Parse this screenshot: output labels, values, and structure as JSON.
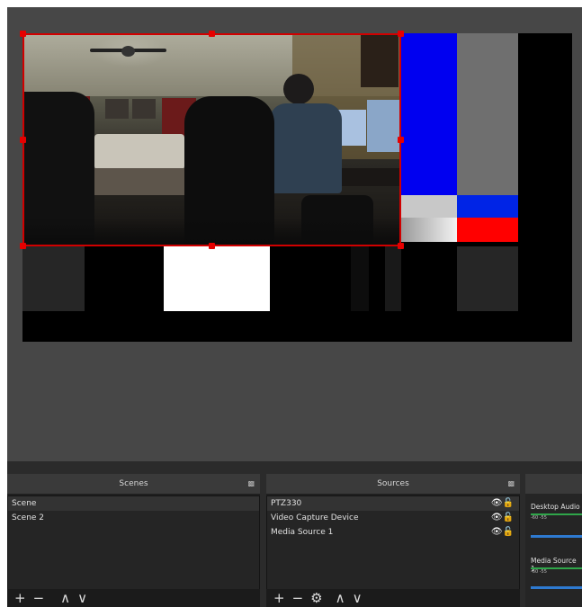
{
  "colors": {
    "accent_red": "#d00000",
    "panel_bg": "#2b2b2b",
    "preview_bg": "#474747",
    "meter_green": "#2fa64a",
    "meter_blue": "#2e7ad1"
  },
  "scenes": {
    "title": "Scenes",
    "items": [
      "Scene",
      "Scene 2"
    ],
    "toolbar": {
      "add": "+",
      "remove": "−",
      "up": "∧",
      "down": "∨"
    }
  },
  "sources": {
    "title": "Sources",
    "items": [
      {
        "name": "PTZ330"
      },
      {
        "name": "Video Capture Device"
      },
      {
        "name": "Media Source 1"
      }
    ],
    "toolbar": {
      "add": "+",
      "remove": "−",
      "settings": "⚙",
      "up": "∧",
      "down": "∨"
    }
  },
  "mixer": {
    "items": [
      {
        "name": "Desktop Audio",
        "ticks": "-60     -55"
      },
      {
        "name": "Media Source 1",
        "ticks": "-60     -55"
      }
    ]
  },
  "icons": {
    "dock_float": "float-icon",
    "visibility": "eye-icon",
    "lock": "lock-icon"
  }
}
